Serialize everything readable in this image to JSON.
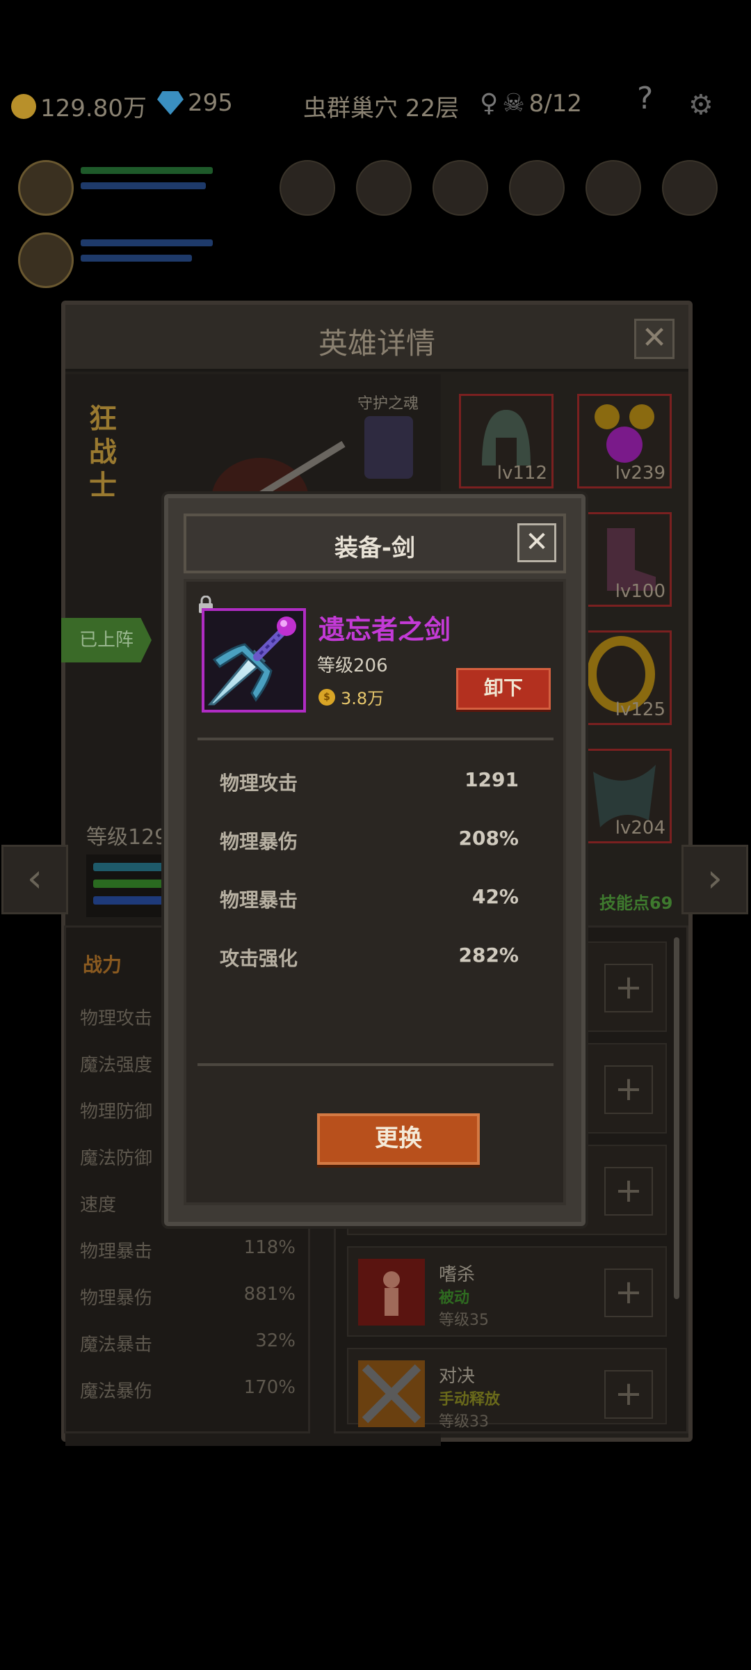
{
  "background": {
    "top_bar": {
      "gold": "129.80万",
      "gems": "295",
      "location": "虫群巢穴 22层",
      "keys": "8/12",
      "help": "?"
    },
    "hero_panel": {
      "title": "英雄详情",
      "close": "✕",
      "hero_name": "狂战士",
      "guardian_label": "守护之魂",
      "status_tag": "已上阵",
      "level": "等级129",
      "skill_points": "技能点69",
      "equip_levels": [
        "lv112",
        "lv239",
        "lv100",
        "lv125",
        "lv204"
      ],
      "stats_title": "战力",
      "stats": [
        {
          "name": "物理攻击",
          "value": ""
        },
        {
          "name": "魔法强度",
          "value": ""
        },
        {
          "name": "物理防御",
          "value": ""
        },
        {
          "name": "魔法防御",
          "value": ""
        },
        {
          "name": "速度",
          "value": ""
        },
        {
          "name": "物理暴击",
          "value": "118%"
        },
        {
          "name": "物理暴伤",
          "value": "881%"
        },
        {
          "name": "魔法暴击",
          "value": "32%"
        },
        {
          "name": "魔法暴伤",
          "value": "170%"
        }
      ],
      "skills": [
        {
          "name": "嗜杀",
          "type": "被动",
          "level": "等级35"
        },
        {
          "name": "对决",
          "type": "手动释放",
          "level": "等级33"
        }
      ],
      "plus": "+",
      "nav_prev": "‹",
      "nav_next": "›"
    }
  },
  "modal": {
    "title": "装备-剑",
    "close": "✕",
    "item": {
      "name": "遗忘者之剑",
      "level": "等级206",
      "price": "3.8万",
      "coin_symbol": "$",
      "rarity_color": "#c33ad6"
    },
    "unequip_label": "卸下",
    "attributes": [
      {
        "name": "物理攻击",
        "value": "1291"
      },
      {
        "name": "物理暴伤",
        "value": "208%"
      },
      {
        "name": "物理暴击",
        "value": "42%"
      },
      {
        "name": "攻击强化",
        "value": "282%"
      }
    ],
    "swap_label": "更换"
  }
}
